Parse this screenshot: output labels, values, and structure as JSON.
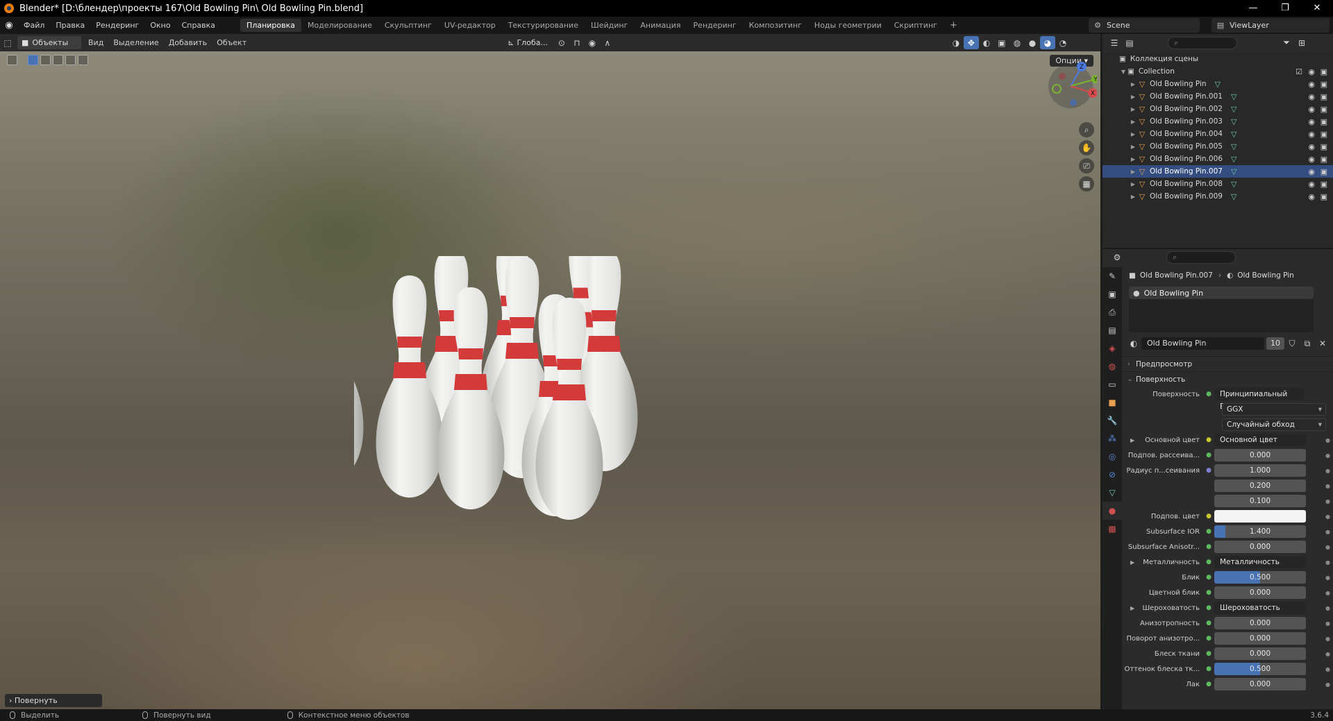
{
  "titlebar": {
    "title": "Blender* [D:\\блендер\\проекты 167\\Old Bowling Pin\\ Old Bowling Pin.blend]",
    "minimize": "—",
    "restore": "❐",
    "close": "✕"
  },
  "menubar": {
    "menus": [
      "Файл",
      "Правка",
      "Рендеринг",
      "Окно",
      "Справка"
    ],
    "workspaces": [
      "Планировка",
      "Моделирование",
      "Скульптинг",
      "UV-редактор",
      "Текстурирование",
      "Шейдинг",
      "Анимация",
      "Рендеринг",
      "Композитинг",
      "Ноды геометрии",
      "Скриптинг"
    ],
    "active_workspace": "Планировка",
    "add_workspace": "+",
    "scene": "Scene",
    "view_layer": "ViewLayer"
  },
  "viewport_header": {
    "mode": "Объекты",
    "menus": [
      "Вид",
      "Выделение",
      "Добавить",
      "Объект"
    ],
    "orientation": "Глоба...",
    "options": "Опции"
  },
  "gizmo": {
    "z": "Z",
    "y": "Y",
    "x": "X"
  },
  "last_operator": "Повернуть",
  "outliner": {
    "scene_collection": "Коллекция сцены",
    "collection": "Collection",
    "objects": [
      "Old Bowling Pin",
      "Old Bowling Pin.001",
      "Old Bowling Pin.002",
      "Old Bowling Pin.003",
      "Old Bowling Pin.004",
      "Old Bowling Pin.005",
      "Old Bowling Pin.006",
      "Old Bowling Pin.007",
      "Old Bowling Pin.008",
      "Old Bowling Pin.009"
    ],
    "selected": "Old Bowling Pin.007"
  },
  "properties": {
    "breadcrumb_object": "Old Bowling Pin.007",
    "breadcrumb_material": "Old Bowling Pin",
    "slot": "Old Bowling Pin",
    "material_name": "Old Bowling Pin",
    "users": "10",
    "sections": {
      "preview": "Предпросмотр",
      "surface": "Поверхность"
    },
    "surface_label": "Поверхность",
    "surface_value": "Принципиальный BSDF",
    "distribution": "GGX",
    "subsurface_method": "Случайный обход",
    "rows": [
      {
        "label": "Основной цвет",
        "kind": "node",
        "value": "Основной цвет",
        "expand": true,
        "socket": "yel"
      },
      {
        "label": "Подпов. рассеива...",
        "kind": "num",
        "value": "0.000",
        "fill": 0,
        "socket": "gr"
      },
      {
        "label": "Радиус п...сеивания",
        "kind": "num",
        "value": "1.000",
        "fill": 0,
        "socket": "pu"
      },
      {
        "label": "",
        "kind": "num",
        "value": "0.200",
        "fill": 0,
        "socket": ""
      },
      {
        "label": "",
        "kind": "num",
        "value": "0.100",
        "fill": 0,
        "socket": ""
      },
      {
        "label": "Подпов. цвет",
        "kind": "color",
        "value": "",
        "socket": "yel"
      },
      {
        "label": "Subsurface IOR",
        "kind": "num",
        "value": "1.400",
        "fill": 0.12,
        "socket": "gr"
      },
      {
        "label": "Subsurface Anisotr...",
        "kind": "num",
        "value": "0.000",
        "fill": 0,
        "socket": "gr"
      },
      {
        "label": "Металличность",
        "kind": "node",
        "value": "Металличность",
        "expand": true,
        "socket": "gr"
      },
      {
        "label": "Блик",
        "kind": "num",
        "value": "0.500",
        "fill": 0.5,
        "socket": "gr"
      },
      {
        "label": "Цветной блик",
        "kind": "num",
        "value": "0.000",
        "fill": 0,
        "socket": "gr"
      },
      {
        "label": "Шероховатость",
        "kind": "node",
        "value": "Шероховатость",
        "expand": true,
        "socket": "gr"
      },
      {
        "label": "Анизотропность",
        "kind": "num",
        "value": "0.000",
        "fill": 0,
        "socket": "gr"
      },
      {
        "label": "Поворот анизотро...",
        "kind": "num",
        "value": "0.000",
        "fill": 0,
        "socket": "gr"
      },
      {
        "label": "Блеск ткани",
        "kind": "num",
        "value": "0.000",
        "fill": 0,
        "socket": "gr"
      },
      {
        "label": "Оттенок блеска тк...",
        "kind": "num",
        "value": "0.500",
        "fill": 0.5,
        "socket": "gr"
      },
      {
        "label": "Лак",
        "kind": "num",
        "value": "0.000",
        "fill": 0,
        "socket": "gr"
      }
    ]
  },
  "statusbar": {
    "select": "Выделить",
    "rotate_view": "Повернуть вид",
    "context_menu": "Контекстное меню объектов",
    "version": "3.6.4"
  },
  "colors": {
    "accent": "#4772b3",
    "selection": "#334d80",
    "pin_white": "#e8e8e6",
    "pin_red": "#d33b3b",
    "mesh_icon": "#6fc9a0",
    "object_icon": "#e8a050"
  }
}
